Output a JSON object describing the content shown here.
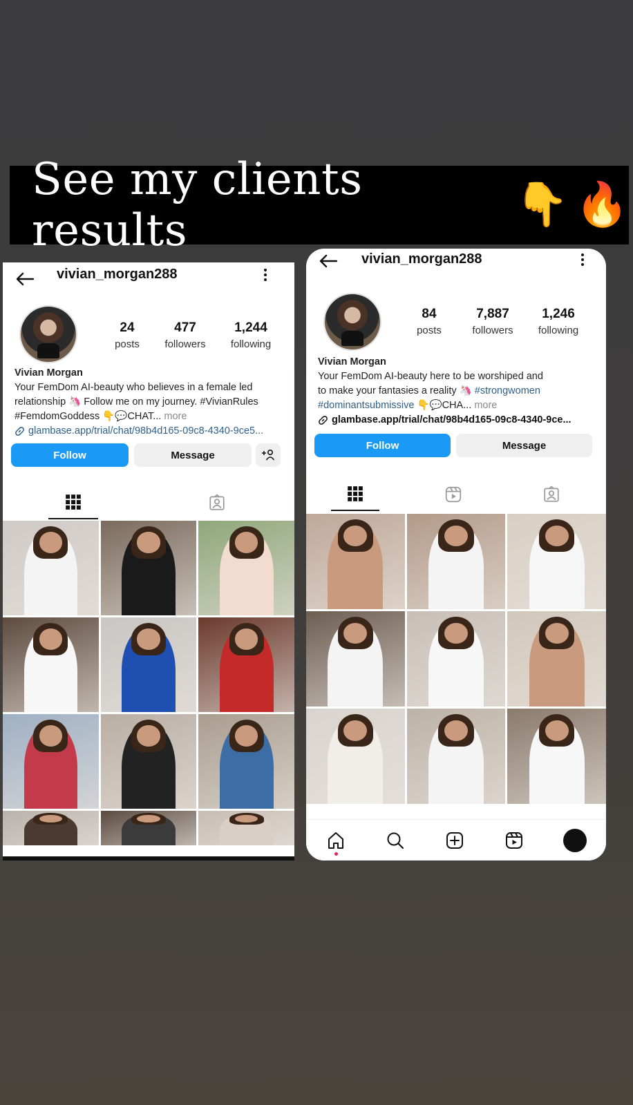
{
  "banner": {
    "text": "See my clients results",
    "emoji_point": "👇",
    "emoji_fire": "🔥"
  },
  "left_profile": {
    "username": "vivian_morgan288",
    "stats": [
      {
        "value": "24",
        "label": "posts"
      },
      {
        "value": "477",
        "label": "followers"
      },
      {
        "value": "1,244",
        "label": "following"
      }
    ],
    "name": "Vivian Morgan",
    "bio_line1": "Your FemDom AI-beauty who believes in a female led",
    "bio_line2": "relationship 🦄 Follow me on my journey.  #VivianRules",
    "bio_line3_a": "#FemdomGoddess 👇💬CHAT...",
    "bio_more": "more",
    "link": "glambase.app/trial/chat/98b4d165-09c8-4340-9ce5...",
    "follow_label": "Follow",
    "message_label": "Message",
    "add_user_label": "+‍👤",
    "tiles": [
      "#cfcac6",
      "#7a6a5c",
      "#8fa77a",
      "#5e4b3e",
      "#c9c6c3",
      "#6b3a2c",
      "#9fb0c4",
      "#b9aea4",
      "#a99d8f",
      "#b8b2ab",
      "#5a4a40",
      "#c6bdb5"
    ],
    "outfits": [
      "#f4f4f4",
      "#1a1a1a",
      "#f2dcd0",
      "#f7f7f7",
      "#1f4fb0",
      "#c42a2a",
      "#c33b4a",
      "#222222",
      "#3c6ea5",
      "#4a3a30",
      "#3b3b3b",
      "#d9cfc6"
    ]
  },
  "right_profile": {
    "username": "vivian_morgan288",
    "stats": [
      {
        "value": "84",
        "label": "posts"
      },
      {
        "value": "7,887",
        "label": "followers"
      },
      {
        "value": "1,246",
        "label": "following"
      }
    ],
    "name": "Vivian Morgan",
    "bio_line1": "Your FemDom AI-beauty here to be worshiped and",
    "bio_line2_a": "to make your fantasies a reality 🦄",
    "bio_line2_tag": "#strongwomen",
    "bio_line3_tag": "#dominantsubmissive",
    "bio_line3_b": "👇💬CHA...",
    "bio_more": "more",
    "link": "glambase.app/trial/chat/98b4d165-09c8-4340-9ce...",
    "follow_label": "Follow",
    "message_label": "Message",
    "tiles": [
      "#bfa899",
      "#b39a88",
      "#d8cfc4",
      "#6e5e52",
      "#c7bfb7",
      "#d2c7bb",
      "#d9d4cf",
      "#bdb2a7",
      "#8a7a6c"
    ],
    "outfits": [
      "#c99a7d",
      "#f4f4f4",
      "#f6f6f6",
      "#f4f4f4",
      "#f7f7f7",
      "#c99a7d",
      "#f1eeea",
      "#f4f4f4",
      "#f7f7f7"
    ]
  }
}
